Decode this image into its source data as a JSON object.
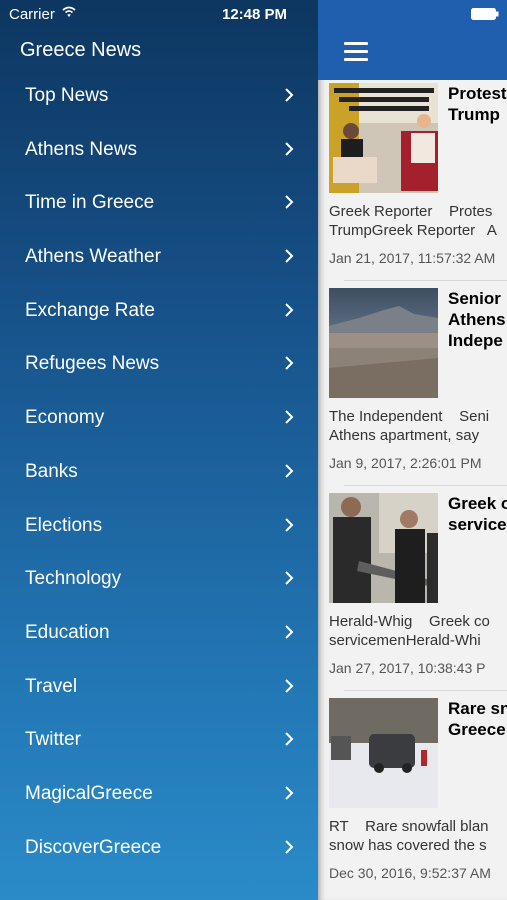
{
  "status_bar": {
    "carrier": "Carrier",
    "time": "12:48 PM"
  },
  "drawer": {
    "title": "Greece News",
    "items": [
      {
        "label": "Top News"
      },
      {
        "label": "Athens News"
      },
      {
        "label": "Time in Greece"
      },
      {
        "label": "Athens Weather"
      },
      {
        "label": "Exchange Rate"
      },
      {
        "label": "Refugees News"
      },
      {
        "label": "Economy"
      },
      {
        "label": "Banks"
      },
      {
        "label": "Elections"
      },
      {
        "label": "Technology"
      },
      {
        "label": "Education"
      },
      {
        "label": "Travel"
      },
      {
        "label": "Twitter"
      },
      {
        "label": "MagicalGreece"
      },
      {
        "label": "DiscoverGreece"
      }
    ]
  },
  "colors": {
    "drawer_top": "#0d3660",
    "drawer_bottom": "#2a8bc8",
    "navbar": "#1f5fae"
  },
  "icons": {
    "menu": "hamburger-icon",
    "item": "chevron-right-icon",
    "wifi": "wifi-icon",
    "battery": "battery-icon"
  },
  "articles": [
    {
      "headline": "Protest\nTrump",
      "source_line1": "Greek Reporter    Protes",
      "source_line2": "TrumpGreek Reporter   A",
      "date": "Jan 21, 2017, 11:57:32 AM"
    },
    {
      "headline": "Senior\nAthens\nIndepe",
      "source_line1": "The Independent    Seni",
      "source_line2": "Athens apartment, say",
      "date": "Jan 9, 2017, 2:26:01 PM"
    },
    {
      "headline": "Greek o\nservice",
      "source_line1": "Herald-Whig    Greek co",
      "source_line2": "servicemenHerald-Whi",
      "date": "Jan 27, 2017, 10:38:43 P"
    },
    {
      "headline": "Rare sn\nGreece",
      "source_line1": "RT    Rare snowfall blan",
      "source_line2": "snow has covered the s",
      "date": "Dec 30, 2016, 9:52:37 AM"
    }
  ]
}
